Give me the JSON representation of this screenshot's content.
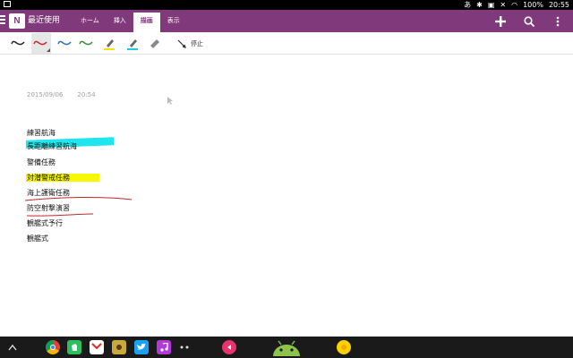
{
  "status_bar": {
    "left_icon": "gallery-icon",
    "ime": "あ",
    "battery_label": "100%",
    "time": "20:55"
  },
  "app": {
    "notebook_title": "最近使用",
    "logo_text": "N",
    "tabs": [
      {
        "label": "ホーム",
        "active": false
      },
      {
        "label": "挿入",
        "active": false
      },
      {
        "label": "描画",
        "active": true
      },
      {
        "label": "表示",
        "active": false
      }
    ],
    "accent_color": "#80397b"
  },
  "ribbon": {
    "tools": [
      {
        "name": "pen-black",
        "color": "#222222"
      },
      {
        "name": "pen-red",
        "color": "#c0282d",
        "selected": true
      },
      {
        "name": "pen-blue",
        "color": "#2a6fb0"
      },
      {
        "name": "pen-green",
        "color": "#2f8a3c"
      },
      {
        "name": "highlighter-yellow",
        "color": "#f4e400"
      },
      {
        "name": "highlighter-cyan",
        "color": "#1ecbe1"
      },
      {
        "name": "eraser",
        "color": "#888888"
      }
    ],
    "stop_label": "停止"
  },
  "page": {
    "date": "2015/09/06",
    "time": "20:54",
    "lines": [
      {
        "text": "練習航海"
      },
      {
        "text": "長距離練習航海",
        "highlight": "#1ee6ef"
      },
      {
        "text": "警備任務"
      },
      {
        "text": "対潜警戒任務",
        "highlight": "#f7f700"
      },
      {
        "text": "海上護衛任務",
        "underline": "#c0282d"
      },
      {
        "text": "防空射撃演習",
        "underline": "#c0282d"
      },
      {
        "text": "観艦式予行"
      },
      {
        "text": "観艦式"
      }
    ]
  },
  "nav_bar": {
    "apps": [
      "chrome-icon",
      "evernote-icon",
      "gmail-icon",
      "app-icon",
      "twitter-icon",
      "music-icon",
      "more-dots-icon",
      "pink-app-icon",
      "android-icon",
      "yellow-app-icon"
    ]
  }
}
